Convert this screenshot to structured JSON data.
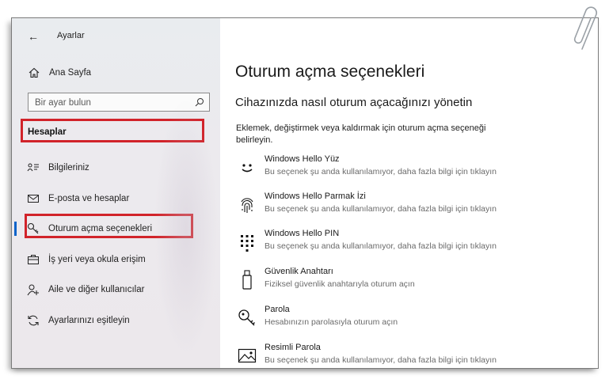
{
  "window": {
    "title": "Ayarlar",
    "back_symbol": "←"
  },
  "sidebar": {
    "home_label": "Ana Sayfa",
    "search_placeholder": "Bir ayar bulun",
    "section_title": "Hesaplar",
    "items": [
      {
        "label": "Bilgileriniz",
        "icon": "person-card-icon"
      },
      {
        "label": "E-posta ve hesaplar",
        "icon": "mail-icon"
      },
      {
        "label": "Oturum açma seçenekleri",
        "icon": "key-icon",
        "active": true
      },
      {
        "label": "İş yeri veya okula erişim",
        "icon": "briefcase-icon"
      },
      {
        "label": "Aile ve diğer kullanıcılar",
        "icon": "person-add-icon"
      },
      {
        "label": "Ayarlarınızı eşitleyin",
        "icon": "sync-icon"
      }
    ]
  },
  "main": {
    "title": "Oturum açma seçenekleri",
    "subtitle": "Cihazınızda nasıl oturum açacağınızı yönetin",
    "description": "Eklemek, değiştirmek veya kaldırmak için oturum açma seçeneği belirleyin.",
    "options": [
      {
        "title": "Windows Hello Yüz",
        "detail": "Bu seçenek şu anda kullanılamıyor, daha fazla bilgi için tıklayın",
        "icon": "face-icon"
      },
      {
        "title": "Windows Hello Parmak İzi",
        "detail": "Bu seçenek şu anda kullanılamıyor, daha fazla bilgi için tıklayın",
        "icon": "fingerprint-icon"
      },
      {
        "title": "Windows Hello PIN",
        "detail": "Bu seçenek şu anda kullanılamıyor, daha fazla bilgi için tıklayın",
        "icon": "pin-keypad-icon"
      },
      {
        "title": "Güvenlik Anahtarı",
        "detail": "Fiziksel güvenlik anahtarıyla oturum açın",
        "icon": "usb-key-icon"
      },
      {
        "title": "Parola",
        "detail": "Hesabınızın parolasıyla oturum açın",
        "icon": "password-key-icon"
      },
      {
        "title": "Resimli Parola",
        "detail": "Bu seçenek şu anda kullanılamıyor, daha fazla bilgi için tıklayın",
        "icon": "picture-icon"
      }
    ]
  },
  "colors": {
    "highlight_box": "#d1232a",
    "active_indicator": "#0b63c9"
  }
}
